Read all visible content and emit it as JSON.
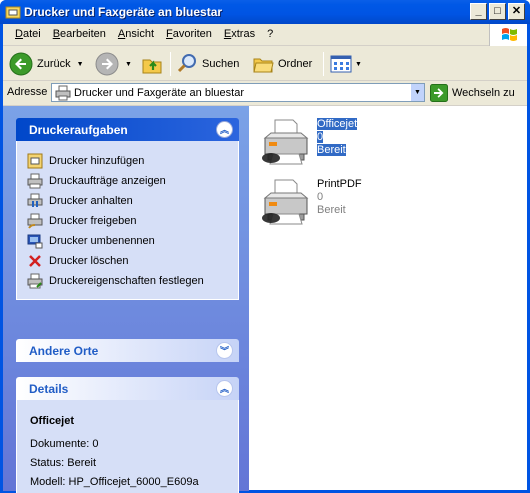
{
  "window": {
    "title": "Drucker und Faxgeräte an bluestar"
  },
  "titlebar_buttons": {
    "minimize": "_",
    "maximize": "□",
    "close": "✕"
  },
  "menu": [
    "Datei",
    "Bearbeiten",
    "Ansicht",
    "Favoriten",
    "Extras",
    "?"
  ],
  "toolbar": {
    "back": "Zurück",
    "search": "Suchen",
    "folders": "Ordner"
  },
  "address": {
    "label": "Adresse",
    "value": "Drucker und Faxgeräte an bluestar",
    "go": "Wechseln zu"
  },
  "tasks_panel": {
    "title": "Druckeraufgaben",
    "items": [
      {
        "label": "Drucker hinzufügen",
        "icon": "add-printer-icon"
      },
      {
        "label": "Druckaufträge anzeigen",
        "icon": "view-jobs-icon"
      },
      {
        "label": "Drucker anhalten",
        "icon": "pause-printer-icon"
      },
      {
        "label": "Drucker freigeben",
        "icon": "share-printer-icon"
      },
      {
        "label": "Drucker umbenennen",
        "icon": "rename-printer-icon"
      },
      {
        "label": "Drucker löschen",
        "icon": "delete-icon"
      },
      {
        "label": "Druckereigenschaften festlegen",
        "icon": "printer-properties-icon"
      }
    ]
  },
  "other_places": {
    "title": "Andere Orte"
  },
  "details": {
    "title": "Details",
    "name": "Officejet",
    "documents": "Dokumente: 0",
    "status": "Status: Bereit",
    "model": "Modell: HP_Officejet_6000_E609a"
  },
  "printers": [
    {
      "name": "Officejet",
      "jobs": "0",
      "status": "Bereit",
      "selected": true
    },
    {
      "name": "PrintPDF",
      "jobs": "0",
      "status": "Bereit",
      "selected": false
    }
  ],
  "colors": {
    "title_blue": "#0054e3",
    "task_bg": "#7ba2e7",
    "selection": "#316ac5"
  }
}
